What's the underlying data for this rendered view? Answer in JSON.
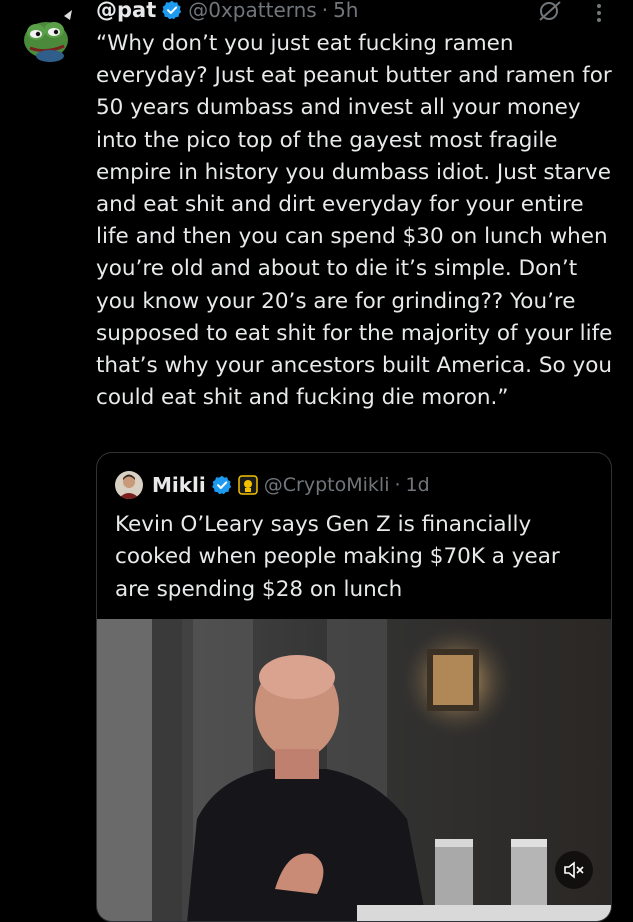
{
  "tweet": {
    "display_name": "@pat",
    "handle": "@0xpatterns",
    "separator": "·",
    "time": "5h",
    "text": "“Why don’t you just eat fucking ramen everyday? Just eat peanut butter and ramen for 50 years dumbass and invest all your money into the pico top of the gayest most fragile empire in history you dumbass idiot. Just starve and eat shit and dirt everyday for your entire life and then you can spend $30 on lunch when you’re old and about to die it’s simple. Don’t you know your 20’s are for grinding?? You’re supposed to eat shit for the majority of your life that’s why your ancestors built America. So you could eat shit and fucking die moron.”",
    "avatar_icon": "pepe-frog-avatar-icon",
    "verified_icon": "verified-badge-icon",
    "grok_icon": "grok-icon",
    "more_icon": "more-options-icon"
  },
  "quote": {
    "display_name": "Mikli",
    "handle": "@CryptoMikli",
    "separator": "·",
    "time": "1d",
    "text": "Kevin O’Leary says Gen Z is financially cooked when people making $70K a year are spending $28 on lunch",
    "avatar_icon": "mikli-avatar-icon",
    "verified_icon": "verified-badge-icon",
    "affiliate_icon": "affiliate-badge-icon",
    "media_icon": "video-thumbnail",
    "mute_icon": "volume-muted-icon"
  },
  "colors": {
    "background": "#000000",
    "text": "#e7e9ea",
    "muted": "#71767b",
    "verified": "#1d9bf0",
    "border": "#2f3336"
  }
}
